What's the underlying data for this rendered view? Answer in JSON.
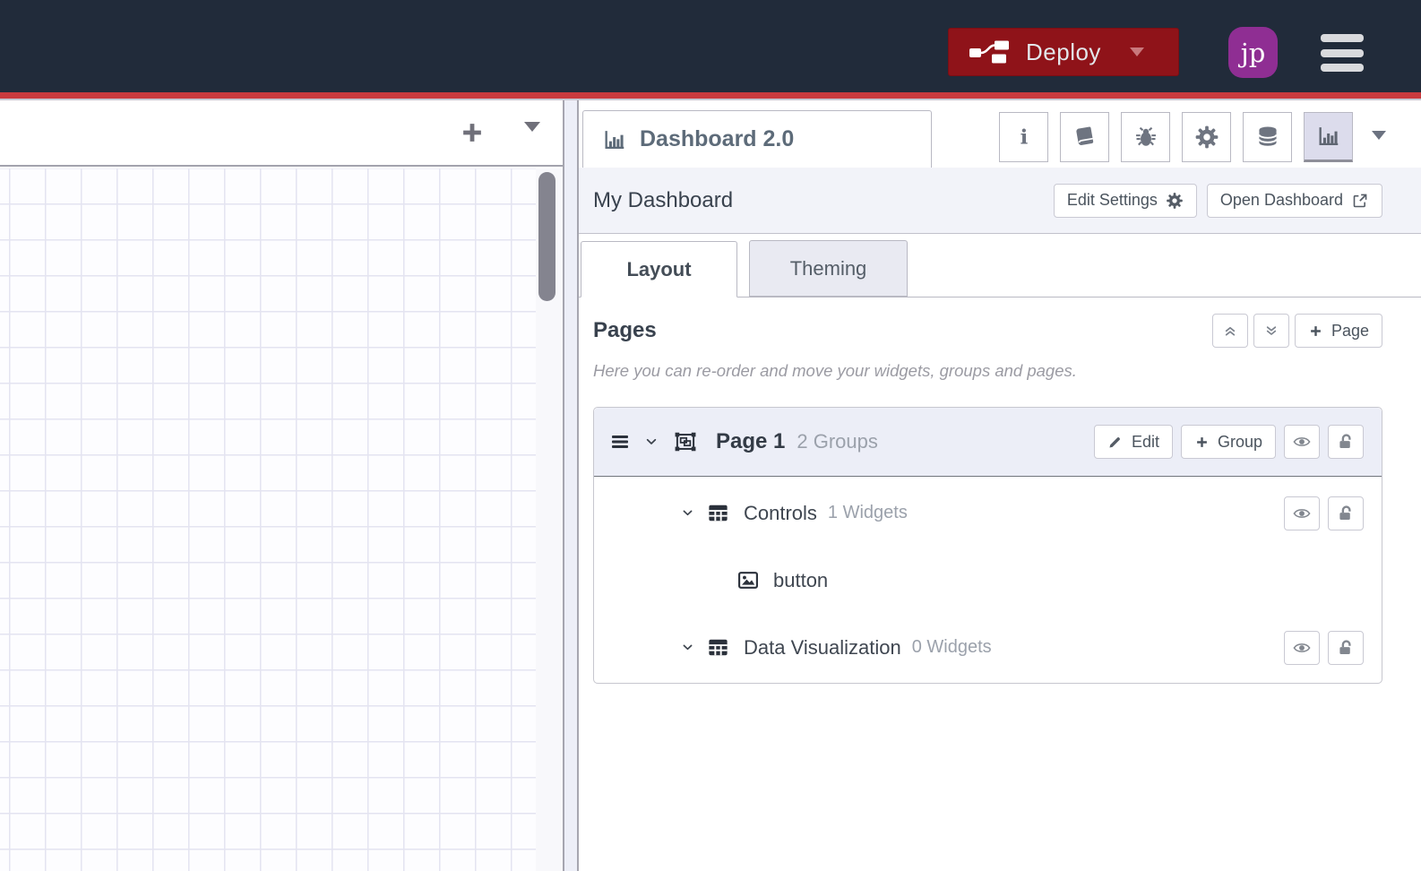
{
  "colors": {
    "header_bg": "#212b3a",
    "accent_red": "#c93a3e",
    "deploy_bg": "#8f1319",
    "avatar_bg": "#8f2e93",
    "active_panel_bg": "#dcdcec",
    "section_bg": "#f2f3f9",
    "card_header_bg": "#eceef7",
    "tab_inactive_bg": "#e9eaf2"
  },
  "header": {
    "deploy_label": "Deploy",
    "avatar_initials": "jp",
    "icons": [
      "deploy-wire-icon",
      "deploy-caret-icon",
      "main-menu-icon"
    ]
  },
  "canvas": {
    "icons": [
      "add-flow-icon",
      "flow-list-caret-icon"
    ]
  },
  "sidebar": {
    "tab_title": "Dashboard 2.0",
    "tab_icon": "chart-bar-icon",
    "panel_icons": [
      "info-icon",
      "book-icon",
      "bug-icon",
      "gear-icon",
      "database-icon",
      "chart-bar-icon",
      "caret-down-icon"
    ],
    "dashboard_name": "My Dashboard",
    "edit_settings_label": "Edit Settings",
    "open_dashboard_label": "Open Dashboard",
    "tabs": [
      {
        "label": "Layout",
        "active": true
      },
      {
        "label": "Theming",
        "active": false
      }
    ],
    "pages_heading": "Pages",
    "collapse_icon": "angles-up-icon",
    "expand_icon": "angles-down-icon",
    "add_page_label": "Page",
    "hint": "Here you can re-order and move your widgets, groups and pages.",
    "page": {
      "name": "Page 1",
      "count": "2 Groups",
      "edit_label": "Edit",
      "add_group_label": "Group",
      "icons": [
        "drag-handle-icon",
        "chevron-down-icon",
        "object-group-icon",
        "pencil-icon",
        "plus-icon",
        "eye-icon",
        "unlock-icon"
      ],
      "groups": [
        {
          "name": "Controls",
          "count": "1 Widgets",
          "widgets": [
            {
              "name": "button",
              "icon": "image-icon"
            }
          ]
        },
        {
          "name": "Data Visualization",
          "count": "0 Widgets",
          "widgets": []
        }
      ]
    }
  }
}
